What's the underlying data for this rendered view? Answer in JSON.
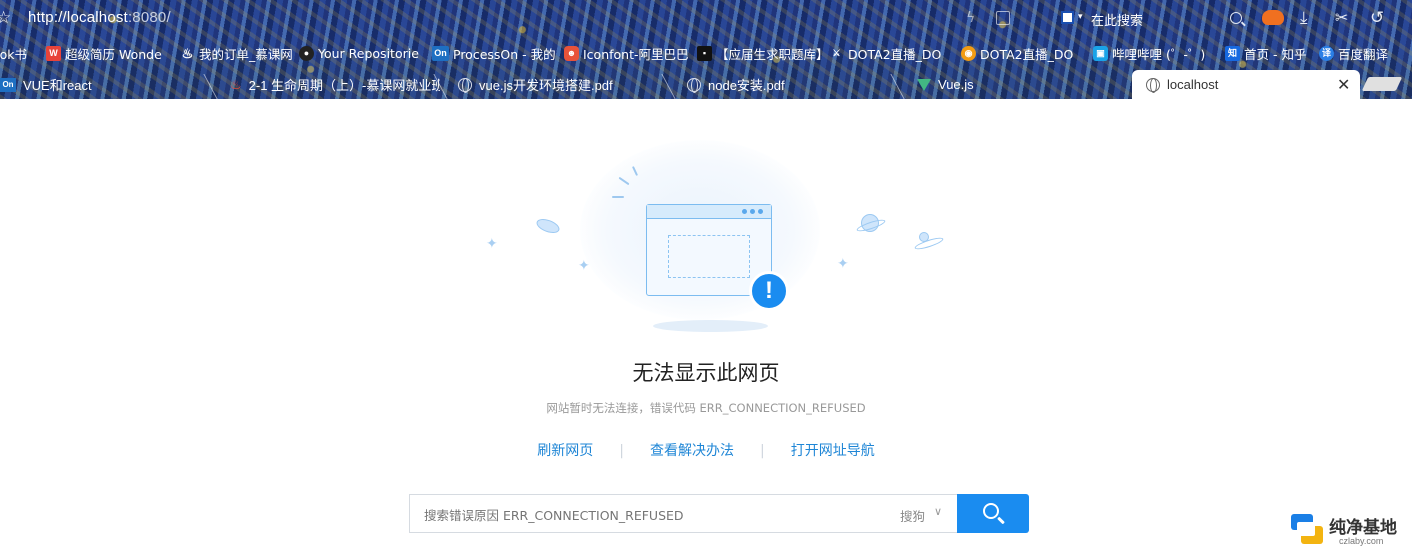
{
  "address_bar": {
    "url_main": "http://localhost",
    "url_port": ":8080/",
    "search_label": "在此搜索"
  },
  "bookmarks": [
    {
      "label": "ook书",
      "icon": "",
      "color": "transparent"
    },
    {
      "label": "超级简历 Wonde",
      "icon": "W",
      "color": "#e8433a"
    },
    {
      "label": "我的订单_慕课网",
      "icon": "火",
      "color": "transparent"
    },
    {
      "label": "Your Repositorie",
      "icon": "gh",
      "color": "#222222"
    },
    {
      "label": "ProcessOn - 我的",
      "icon": "On",
      "color": "#1e6fc2"
    },
    {
      "label": "Iconfont-阿里巴巴",
      "icon": "i",
      "color": "#e8533a"
    },
    {
      "label": "【应届生求职题库】",
      "icon": "d",
      "color": "#111111"
    },
    {
      "label": "DOTA2直播_DO",
      "icon": "d",
      "color": "transparent"
    },
    {
      "label": "DOTA2直播_DO",
      "icon": "斗",
      "color": "#f39c12"
    },
    {
      "label": "哔哩哔哩 (゜-゜)",
      "icon": "tv",
      "color": "#1aa3e8"
    },
    {
      "label": "首页 - 知乎",
      "icon": "知",
      "color": "#1769e0"
    },
    {
      "label": "百度翻译",
      "icon": "译",
      "color": "#2a7fe6"
    }
  ],
  "tabs": [
    {
      "label": "VUE和react",
      "icon": "On"
    },
    {
      "label": "2-1 生命周期（上）-慕课网就业班",
      "icon": "fire"
    },
    {
      "label": "vue.js开发环境搭建.pdf",
      "icon": "globe"
    },
    {
      "label": "node安装.pdf",
      "icon": "globe"
    },
    {
      "label": "Vue.js",
      "icon": "vue"
    },
    {
      "label": "localhost",
      "icon": "globe",
      "active": true
    }
  ],
  "error": {
    "title": "无法显示此网页",
    "subtitle": "网站暂时无法连接，错误代码 ERR_CONNECTION_REFUSED",
    "actions": [
      "刷新网页",
      "查看解决办法",
      "打开网址导航"
    ],
    "search_placeholder": "搜索错误原因 ERR_CONNECTION_REFUSED",
    "engine": "搜狗"
  },
  "watermark": {
    "title": "纯净基地",
    "url": "czlaby.com"
  },
  "colors": {
    "accent": "#1a8cf0",
    "link": "#1f86d6"
  }
}
